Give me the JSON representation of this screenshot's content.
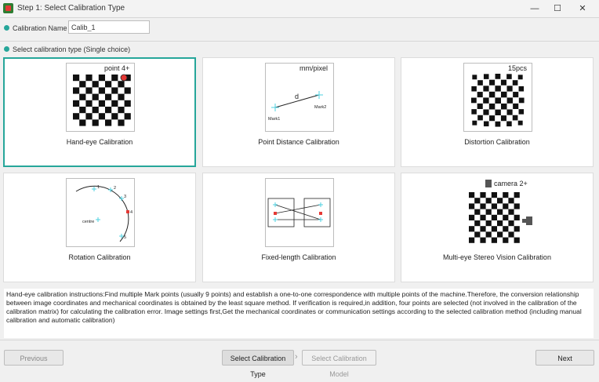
{
  "window": {
    "title": "Step 1: Select Calibration Type",
    "minimize_glyph": "—",
    "maximize_glyph": "☐",
    "close_glyph": "✕"
  },
  "calibration_name": {
    "label": "Calibration Name",
    "value": "Calib_1"
  },
  "section_label": "Select calibration type (Single choice)",
  "cards": {
    "hand_eye": {
      "label": "Hand-eye Calibration",
      "badge": "point 4+"
    },
    "point_distance": {
      "label": "Point Distance Calibration",
      "badge": "mm/pixel",
      "d_label": "d",
      "mark1": "Mark1",
      "mark2": "Mark2"
    },
    "distortion": {
      "label": "Distortion Calibration",
      "badge": "15pcs"
    },
    "rotation": {
      "label": "Rotation Calibration",
      "centre": "centre",
      "points": [
        "1",
        "2",
        "3",
        "4",
        "5"
      ]
    },
    "fixed_length": {
      "label": "Fixed-length Calibration"
    },
    "multi_eye": {
      "label": "Multi-eye Stereo Vision Calibration",
      "badge": "camera 2+"
    }
  },
  "description": "Hand-eye calibration instructions:Find multiple Mark points (usually 9 points) and establish a one-to-one correspondence with multiple points of the machine.Therefore, the conversion relationship between image coordinates and mechanical coordinates is obtained by the least square method. If verification is required,in addition, four points are selected (not involved in the calibration of the calibration matrix) for calculating the calibration error. Image settings first,Get the mechanical coordinates or communication settings according to the selected calibration method (including manual calibration and automatic calibration)",
  "footer": {
    "previous": "Previous",
    "step1": "Select Calibration Type",
    "step2": "Select Calibration Model",
    "next": "Next",
    "chevron": "›"
  },
  "colors": {
    "accent": "#26a69a",
    "mark": "#4dd0e1",
    "red": "#e53935"
  }
}
